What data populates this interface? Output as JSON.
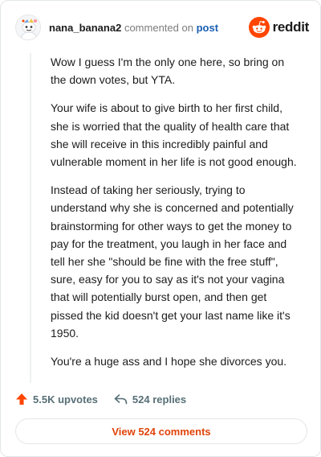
{
  "header": {
    "username": "nana_banana2",
    "commented_on": "commented on",
    "post_link": "post"
  },
  "brand": {
    "name": "reddit",
    "icon": "reddit-alien-icon",
    "color": "#ff4500"
  },
  "comment": {
    "paragraphs": [
      "Wow I guess I'm the only one here, so bring on the down votes, but YTA.",
      "Your wife is about to give birth to her first child, she is worried that the quality of health care that she will receive in this incredibly painful and vulnerable moment in her life is not good enough.",
      "Instead of taking her seriously, trying to understand why she is concerned and potentially brainstorming for other ways to get the money to pay for the treatment, you laugh in her face and tell her she \"should be fine with the free stuff\", sure, easy for you to say as it's not your vagina that will potentially burst open, and then get pissed the kid doesn't get your last name like it's 1950.",
      "You're a huge ass and I hope she divorces you."
    ]
  },
  "actions": {
    "upvotes_label": "5.5K upvotes",
    "replies_label": "524 replies",
    "upvote_icon": "upvote-arrow-icon",
    "reply_icon": "reply-arrow-icon",
    "upvote_color": "#ff4500"
  },
  "view_button": {
    "label": "View 524 comments",
    "color": "#e0440b"
  }
}
